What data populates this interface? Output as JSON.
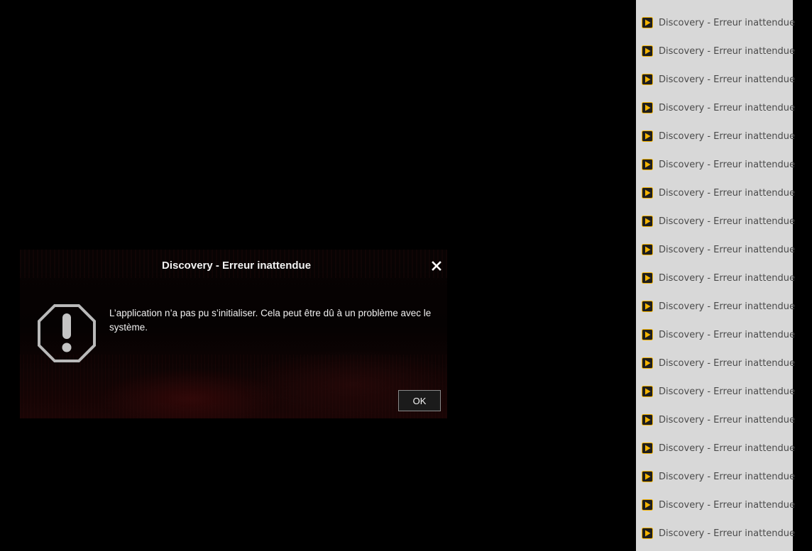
{
  "dialog": {
    "title": "Discovery - Erreur inattendue",
    "message": "L’application n’a pas pu s’initialiser. Cela peut être dû à un problème avec le système.",
    "ok_label": "OK",
    "icon": "warning-icon",
    "close_icon": "close-icon"
  },
  "taskbar": {
    "items": [
      {
        "label": "Discovery - Erreur inattendue",
        "icon": "play-app-icon"
      },
      {
        "label": "Discovery - Erreur inattendue",
        "icon": "play-app-icon"
      },
      {
        "label": "Discovery - Erreur inattendue",
        "icon": "play-app-icon"
      },
      {
        "label": "Discovery - Erreur inattendue",
        "icon": "play-app-icon"
      },
      {
        "label": "Discovery - Erreur inattendue",
        "icon": "play-app-icon"
      },
      {
        "label": "Discovery - Erreur inattendue",
        "icon": "play-app-icon"
      },
      {
        "label": "Discovery - Erreur inattendue",
        "icon": "play-app-icon"
      },
      {
        "label": "Discovery - Erreur inattendue",
        "icon": "play-app-icon"
      },
      {
        "label": "Discovery - Erreur inattendue",
        "icon": "play-app-icon"
      },
      {
        "label": "Discovery - Erreur inattendue",
        "icon": "play-app-icon"
      },
      {
        "label": "Discovery - Erreur inattendue",
        "icon": "play-app-icon"
      },
      {
        "label": "Discovery - Erreur inattendue",
        "icon": "play-app-icon"
      },
      {
        "label": "Discovery - Erreur inattendue",
        "icon": "play-app-icon"
      },
      {
        "label": "Discovery - Erreur inattendue",
        "icon": "play-app-icon"
      },
      {
        "label": "Discovery - Erreur inattendue",
        "icon": "play-app-icon"
      },
      {
        "label": "Discovery - Erreur inattendue",
        "icon": "play-app-icon"
      },
      {
        "label": "Discovery - Erreur inattendue",
        "icon": "play-app-icon"
      },
      {
        "label": "Discovery - Erreur inattendue",
        "icon": "play-app-icon"
      },
      {
        "label": "Discovery - Erreur inattendue",
        "icon": "play-app-icon"
      }
    ]
  },
  "colors": {
    "background": "#000000",
    "panel": "#d8d8d8",
    "icon_accent": "#f5b400",
    "text_light": "#f2f2f2",
    "text_list": "#4a4a4a"
  }
}
